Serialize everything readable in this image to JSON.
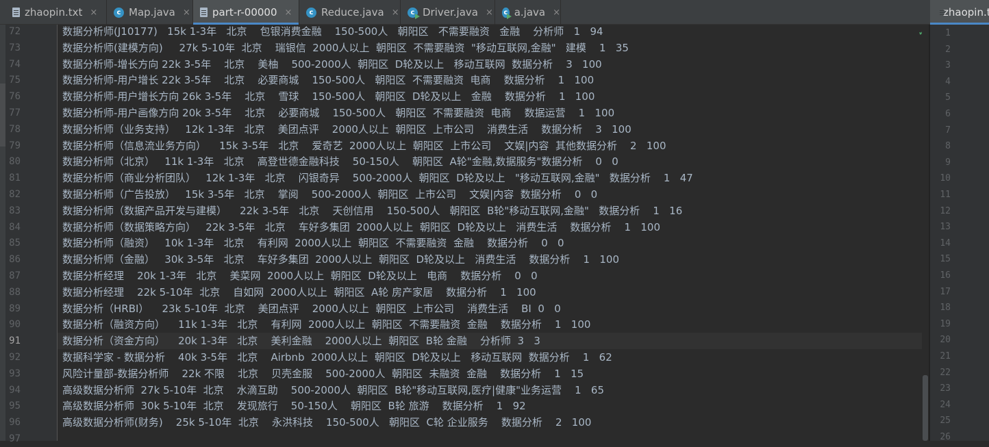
{
  "tabs": [
    {
      "label": "zhaopin.txt",
      "icon": "text-file-icon",
      "active": false
    },
    {
      "label": "Map.java",
      "icon": "java-class-icon",
      "active": false
    },
    {
      "label": "part-r-00000",
      "icon": "text-file-icon",
      "active": true
    },
    {
      "label": "Reduce.java",
      "icon": "java-class-icon",
      "active": false
    },
    {
      "label": "Driver.java",
      "icon": "java-runnable-class-icon",
      "active": false
    },
    {
      "label": "a.java",
      "icon": "java-runnable-class-icon",
      "active": false
    }
  ],
  "close_glyph": "×",
  "right_pane": {
    "tab_label": "zhaopin.txt",
    "line_numbers": [
      "1",
      "2",
      "3",
      "4",
      "5",
      "6",
      "7",
      "8",
      "9",
      "10",
      "11",
      "12",
      "13",
      "14",
      "15",
      "16",
      "17",
      "18",
      "19",
      "20",
      "21",
      "22",
      "23",
      "24",
      "25",
      "26"
    ]
  },
  "editor": {
    "current_line": "91",
    "lines": [
      {
        "num": "72",
        "text": "数据分析师(J10177)   15k 1-3年   北京    包银消费金融    150-500人   朝阳区   不需要融资   金融    分析师   1   94"
      },
      {
        "num": "73",
        "text": "数据分析师(建模方向)     27k 5-10年  北京    瑞银信  2000人以上  朝阳区  不需要融资  \"移动互联网,金融\"   建模    1   35"
      },
      {
        "num": "74",
        "text": "数据分析师-增长方向 22k 3-5年    北京    美柚    500-2000人  朝阳区  D轮及以上   移动互联网  数据分析    3   100"
      },
      {
        "num": "75",
        "text": "数据分析师-用户增长 22k 3-5年    北京    必要商城    150-500人   朝阳区  不需要融资  电商    数据分析    1   100"
      },
      {
        "num": "76",
        "text": "数据分析师-用户增长方向 26k 3-5年    北京    雪球    150-500人   朝阳区  D轮及以上   金融    数据分析    1   100"
      },
      {
        "num": "77",
        "text": "数据分析师-用户画像方向 20k 3-5年    北京    必要商城    150-500人   朝阳区  不需要融资  电商    数据运营    1   100"
      },
      {
        "num": "78",
        "text": "数据分析师（业务支持）   12k 1-3年   北京    美团点评    2000人以上  朝阳区  上市公司    消费生活    数据分析    3   100"
      },
      {
        "num": "79",
        "text": "数据分析师（信息流业务方向）    15k 3-5年   北京    爱奇艺  2000人以上  朝阳区  上市公司    文娱|内容  其他数据分析    2   100"
      },
      {
        "num": "80",
        "text": "数据分析师（北京）   11k 1-3年   北京    高登世德金融科技    50-150人    朝阳区  A轮\"金融,数据服务\"数据分析    0   0"
      },
      {
        "num": "81",
        "text": "数据分析师（商业分析团队）   12k 1-3年   北京    闪银奇异    500-2000人  朝阳区  D轮及以上   \"移动互联网,金融\"   数据分析    1   47"
      },
      {
        "num": "82",
        "text": "数据分析师（广告投放）   15k 3-5年   北京    掌阅    500-2000人  朝阳区  上市公司    文娱|内容  数据分析    0   0"
      },
      {
        "num": "83",
        "text": "数据分析师（数据产品开发与建模）    22k 3-5年   北京    天创信用    150-500人   朝阳区  B轮\"移动互联网,金融\"   数据分析    1   16"
      },
      {
        "num": "84",
        "text": "数据分析师（数据策略方向）   22k 3-5年   北京    车好多集团  2000人以上  朝阳区  D轮及以上   消费生活    数据分析    1   100"
      },
      {
        "num": "85",
        "text": "数据分析师（融资）   10k 1-3年   北京    有利网  2000人以上  朝阳区  不需要融资  金融    数据分析    0   0"
      },
      {
        "num": "86",
        "text": "数据分析师（金融）   30k 3-5年   北京    车好多集团  2000人以上  朝阳区  D轮及以上   消费生活    数据分析    1   100"
      },
      {
        "num": "87",
        "text": "数据分析经理    20k 1-3年   北京    美菜网  2000人以上  朝阳区  D轮及以上   电商    数据分析    0   0"
      },
      {
        "num": "88",
        "text": "数据分析经理    22k 5-10年  北京    自如网  2000人以上  朝阳区  A轮 房产家居    数据分析    1   100"
      },
      {
        "num": "89",
        "text": "数据分析（HRBI）    23k 5-10年  北京    美团点评    2000人以上  朝阳区  上市公司    消费生活    BI  0   0"
      },
      {
        "num": "90",
        "text": "数据分析（融资方向）    11k 1-3年   北京    有利网  2000人以上  朝阳区  不需要融资  金融    数据分析    1   100"
      },
      {
        "num": "91",
        "text": "数据分析（资金方向）    20k 1-3年   北京    美利金融    2000人以上  朝阳区  B轮 金融    分析师  3   3"
      },
      {
        "num": "92",
        "text": "数据科学家 - 数据分析    40k 3-5年   北京    Airbnb  2000人以上  朝阳区  D轮及以上   移动互联网  数据分析    1   62"
      },
      {
        "num": "93",
        "text": "风险计量部-数据分析师    22k 不限    北京    贝壳金服    500-2000人  朝阳区  未融资  金融    数据分析    1   15"
      },
      {
        "num": "94",
        "text": "高级数据分析师  27k 5-10年  北京    水滴互助    500-2000人  朝阳区  B轮\"移动互联网,医疗|健康\"业务运营    1   65"
      },
      {
        "num": "95",
        "text": "高级数据分析师  30k 5-10年  北京    发现旅行    50-150人    朝阳区  B轮 旅游    数据分析    1   92"
      },
      {
        "num": "96",
        "text": "高级数据分析师(财务)    25k 5-10年  北京    永洪科技    150-500人   朝阳区  C轮 企业服务    数据分析    2   100"
      },
      {
        "num": "97",
        "text": ""
      }
    ]
  }
}
